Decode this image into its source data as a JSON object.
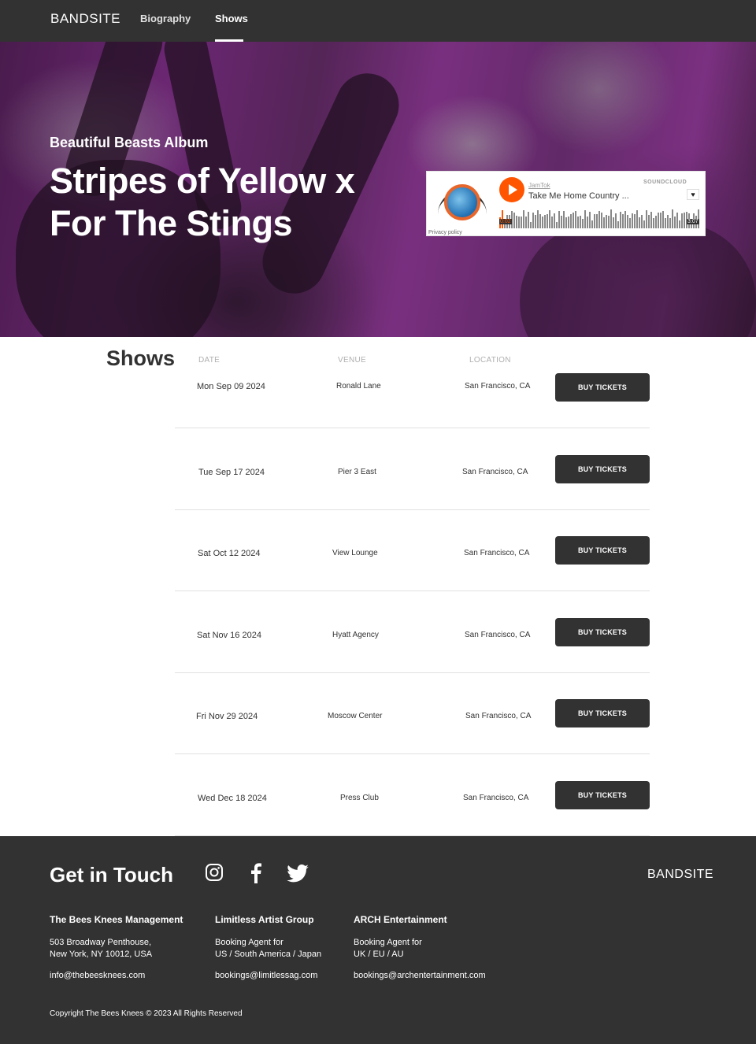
{
  "nav": {
    "brand": "BANDSITE",
    "links": [
      {
        "label": "Biography"
      },
      {
        "label": "Shows"
      }
    ],
    "active": "Shows"
  },
  "hero": {
    "subtitle": "Beautiful Beasts Album",
    "title": "Stripes of Yellow x For The Stings"
  },
  "player": {
    "user": "JamTok",
    "track": "Take Me Home Country ...",
    "logo": "SOUNDCLOUD",
    "privacy": "Privacy policy",
    "elapsed": "0:02",
    "duration": "3:07",
    "accent": "#ff5500"
  },
  "shows": {
    "title": "Shows",
    "columns": {
      "date": "DATE",
      "venue": "VENUE",
      "location": "LOCATION"
    },
    "button_label": "BUY TICKETS",
    "rows": [
      {
        "date": "Mon Sep 09 2024",
        "venue": "Ronald Lane",
        "location": "San Francisco, CA"
      },
      {
        "date": "Tue Sep 17 2024",
        "venue": "Pier 3 East",
        "location": "San Francisco, CA"
      },
      {
        "date": "Sat Oct 12 2024",
        "venue": "View Lounge",
        "location": "San Francisco, CA"
      },
      {
        "date": "Sat Nov 16 2024",
        "venue": "Hyatt Agency",
        "location": "San Francisco, CA"
      },
      {
        "date": "Fri Nov 29 2024",
        "venue": "Moscow Center",
        "location": "San Francisco, CA"
      },
      {
        "date": "Wed Dec 18 2024",
        "venue": "Press Club",
        "location": "San Francisco, CA"
      }
    ]
  },
  "footer": {
    "title": "Get in Touch",
    "brand": "BANDSITE",
    "social": [
      "instagram-icon",
      "facebook-icon",
      "twitter-icon"
    ],
    "contacts": [
      {
        "name": "The Bees Knees Management",
        "line1": "503 Broadway Penthouse,",
        "line2": "New York, NY 10012, USA",
        "email": "info@thebeesknees.com"
      },
      {
        "name": "Limitless Artist Group",
        "line1": "Booking Agent for",
        "line2": "US / South America / Japan",
        "email": "bookings@limitlessag.com"
      },
      {
        "name": "ARCH Entertainment",
        "line1": "Booking Agent for",
        "line2": "UK / EU / AU",
        "email": "bookings@archentertainment.com"
      }
    ],
    "copyright": "Copyright The Bees Knees © 2023 All Rights Reserved"
  },
  "colors": {
    "primary": "#323232",
    "border": "#e1e1e1",
    "muted": "#afafaf"
  }
}
